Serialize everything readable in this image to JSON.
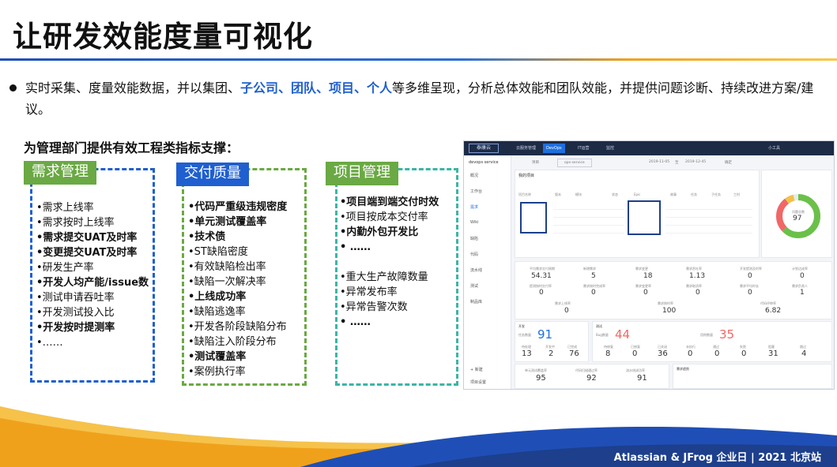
{
  "title": "让研发效能度量可视化",
  "bullet": {
    "part1": "实时采集、度量效能数据，并以集团、",
    "highlight": "子公司、团队、项目、个人",
    "part2": "等多维呈现，分析总体效能和团队效能，并提供问题诊断、持续改进方案/建议。"
  },
  "subheading": "为管理部门提供有效工程类指标支撑：",
  "colors": {
    "green": "#6aa943",
    "blue": "#1f5fd0",
    "teal": "#3bb5a6",
    "navy": "#1d2b45",
    "orange": "#f0a11c"
  },
  "columns": [
    {
      "title": "需求管理",
      "items": [
        {
          "text": "•需求上线率",
          "bold": false
        },
        {
          "text": "•需求按时上线率",
          "bold": false
        },
        {
          "text": "•需求提交UAT及时率",
          "bold": true
        },
        {
          "text": "•变更提交UAT及时率",
          "bold": true
        },
        {
          "text": "•研发生产率",
          "bold": false
        },
        {
          "text": "•开发人均产能/issue数",
          "bold": true
        },
        {
          "text": "•测试申请吞吐率",
          "bold": false
        },
        {
          "text": "•开发测试投入比",
          "bold": false
        },
        {
          "text": "•开发按时提测率",
          "bold": true
        },
        {
          "text": "•……",
          "bold": false
        }
      ]
    },
    {
      "title": "交付质量",
      "items": [
        {
          "text": "•代码严重级违规密度",
          "bold": true
        },
        {
          "text": "•单元测试覆盖率",
          "bold": true
        },
        {
          "text": "•技术债",
          "bold": true
        },
        {
          "text": "•ST缺陷密度",
          "bold": false
        },
        {
          "text": "•有效缺陷检出率",
          "bold": false
        },
        {
          "text": "•缺陷一次解决率",
          "bold": false
        },
        {
          "text": "•上线成功率",
          "bold": true
        },
        {
          "text": "•缺陷逃逸率",
          "bold": false
        },
        {
          "text": "•开发各阶段缺陷分布",
          "bold": false
        },
        {
          "text": "•缺陷注入阶段分布",
          "bold": false
        },
        {
          "text": "•测试覆盖率",
          "bold": true
        },
        {
          "text": "•案例执行率",
          "bold": false
        }
      ]
    },
    {
      "title": "项目管理",
      "items": [
        {
          "text": "•项目端到端交付时效",
          "bold": true
        },
        {
          "text": "•项目按成本交付率",
          "bold": false
        },
        {
          "text": "•内勤外包开发比",
          "bold": true
        },
        {
          "text": "• ……",
          "bold": true
        },
        {
          "text": "",
          "bold": false
        },
        {
          "text": "•重大生产故障数量",
          "bold": false
        },
        {
          "text": "•异常发布率",
          "bold": false
        },
        {
          "text": "•异常告警次数",
          "bold": false
        },
        {
          "text": "• ……",
          "bold": true
        }
      ]
    }
  ],
  "screenshot": {
    "logo": "泰康云",
    "nav": [
      "云服务管理",
      "DevOps",
      "IT运营",
      "监控"
    ],
    "active_nav": "DevOps",
    "user": "小工具",
    "service": "devops service",
    "sidebar": [
      "概况",
      "工作台",
      "需求",
      "Wiki",
      "缺陷",
      "代码",
      "流水线",
      "测试",
      "制品库"
    ],
    "active_sidebar": "需求",
    "filter_label": "项目",
    "filter_value": "ops-service",
    "date_from": "2019-11-05",
    "date_to": "2019-12-45",
    "date_sep": "至",
    "filter_btn": "确定",
    "table_title": "我的项目",
    "table_headers": [
      "项目名称",
      "版本",
      "模块",
      "状态",
      "Epic",
      "故事",
      "任务",
      "子任务",
      "工时"
    ],
    "donut_value": "97",
    "donut_label": "问题总数",
    "metrics_row1": [
      {
        "label": "平均需求交付周期",
        "value": "54.31"
      },
      {
        "label": "新增需求",
        "value": "5"
      },
      {
        "label": "需求变更",
        "value": "18"
      },
      {
        "label": "需求吞吐率",
        "value": "1.13"
      },
      {
        "label": "开发提测及时率",
        "value": "0"
      },
      {
        "label": "计划达成率",
        "value": "0"
      }
    ],
    "metrics_row2": [
      {
        "label": "提测按时交付率",
        "value": "0"
      },
      {
        "label": "需求按时完成率",
        "value": "0"
      },
      {
        "label": "需求变更率",
        "value": "0"
      },
      {
        "label": "需求取消率",
        "value": "0"
      },
      {
        "label": "需求平均时长",
        "value": "0"
      },
      {
        "label": "需求负责人",
        "value": "1"
      }
    ],
    "metrics_row3": [
      {
        "label": "需求上线率",
        "value": "0"
      },
      {
        "label": "需求按时率",
        "value": "100"
      },
      {
        "label": "代码评审率",
        "value": "6.82"
      }
    ],
    "dev": {
      "title": "开发",
      "task_label": "任务数量",
      "task_value": "91",
      "sub": [
        {
          "l": "待处理",
          "v": "13"
        },
        {
          "l": "开发中",
          "v": "2"
        },
        {
          "l": "已完成",
          "v": "76"
        }
      ]
    },
    "test": {
      "title": "测试",
      "bug_label": "Bug数量",
      "bug_value": "44",
      "case_label": "用例数量",
      "case_value": "35",
      "sub": [
        {
          "l": "待修复",
          "v": "8"
        },
        {
          "l": "已修复",
          "v": "0"
        },
        {
          "l": "已关闭",
          "v": "36"
        },
        {
          "l": "未执行",
          "v": "0"
        },
        {
          "l": "通过",
          "v": "0"
        },
        {
          "l": "失败",
          "v": "0"
        },
        {
          "l": "阻塞",
          "v": "31"
        },
        {
          "l": "跳过",
          "v": "4"
        }
      ]
    },
    "bottom": [
      {
        "label": "单元测试覆盖率",
        "value": "95"
      },
      {
        "label": "代码扫描通过率",
        "value": "92"
      },
      {
        "label": "流水线成功率",
        "value": "91"
      }
    ],
    "chart_title": "需求趋势",
    "add_label": "+ 新建",
    "settings_label": "项目设置"
  },
  "footer": "Atlassian & JFrog 企业日 | 2021 北京站"
}
